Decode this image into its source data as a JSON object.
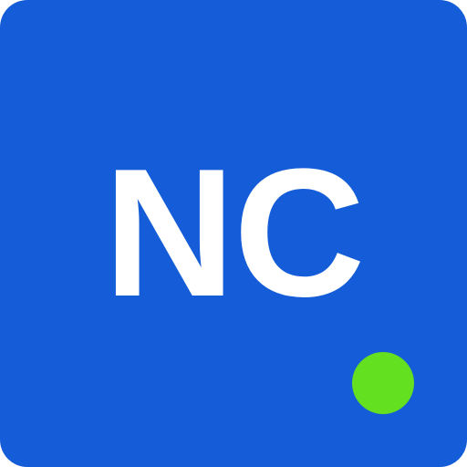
{
  "icon": {
    "monogram": "NC",
    "background_color": "#155DD8",
    "text_color": "#FFFFFF"
  },
  "status_indicator": {
    "state": "online",
    "color": "#63E01F"
  }
}
